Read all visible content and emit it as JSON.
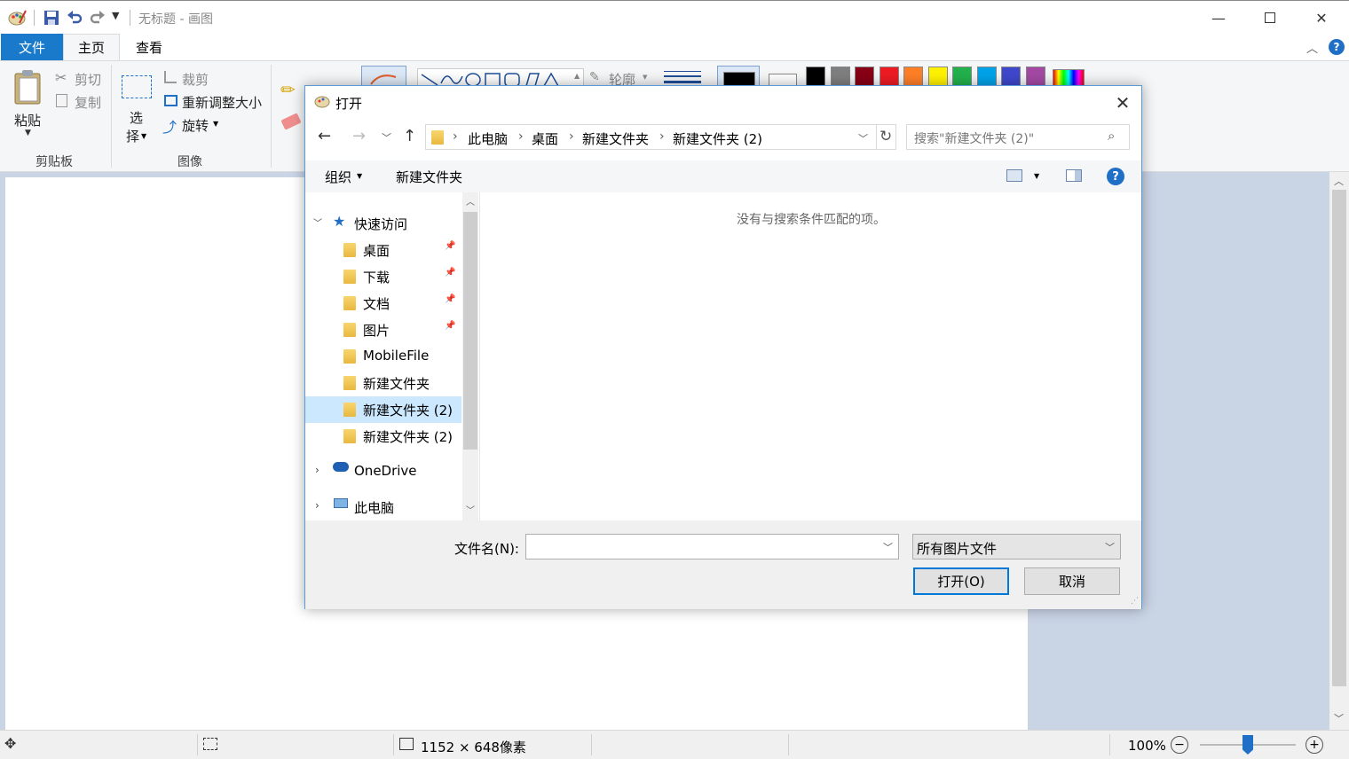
{
  "window": {
    "title": "无标题 - 画图",
    "minimize_icon": "minimize-icon",
    "maximize_icon": "maximize-icon",
    "close_icon": "close-icon"
  },
  "ribbon": {
    "tabs": [
      {
        "label": "文件"
      },
      {
        "label": "主页"
      },
      {
        "label": "查看"
      }
    ],
    "clipboard": {
      "paste_label": "粘贴",
      "cut_label": "剪切",
      "copy_label": "复制",
      "group_label": "剪贴板"
    },
    "image": {
      "select_label": "选",
      "select_label2": "择",
      "crop_label": "裁剪",
      "resize_label": "重新调整大小",
      "rotate_label": "旋转",
      "group_label": "图像"
    },
    "shapes": {
      "outline_label": "轮廓"
    },
    "colors": {
      "color1": "#000000",
      "palette": [
        "#000000",
        "#7f7f7f",
        "#880015",
        "#ed1c24",
        "#ff7f27",
        "#fff200",
        "#22b14c",
        "#00a2e8",
        "#3f48cc",
        "#a349a4"
      ]
    }
  },
  "statusbar": {
    "canvas_size": "1152 × 648像素",
    "zoom": "100%",
    "zoom_out_icon": "zoom-out-icon",
    "zoom_in_icon": "zoom-in-icon",
    "zoom_level": 1.0
  },
  "dialog": {
    "title": "打开",
    "breadcrumb": [
      "此电脑",
      "桌面",
      "新建文件夹",
      "新建文件夹 (2)"
    ],
    "search_placeholder": "搜索\"新建文件夹 (2)\"",
    "organize_label": "组织",
    "new_folder_label": "新建文件夹",
    "nav": {
      "quick_access": "快速访问",
      "items": [
        {
          "label": "桌面",
          "pinned": true
        },
        {
          "label": "下载",
          "pinned": true
        },
        {
          "label": "文档",
          "pinned": true
        },
        {
          "label": "图片",
          "pinned": true
        },
        {
          "label": "MobileFile",
          "pinned": false
        },
        {
          "label": "新建文件夹",
          "pinned": false
        },
        {
          "label": "新建文件夹 (2)",
          "pinned": false,
          "selected": true
        },
        {
          "label": "新建文件夹 (2)",
          "pinned": false
        }
      ],
      "onedrive": "OneDrive",
      "this_pc": "此电脑"
    },
    "empty_message": "没有与搜索条件匹配的项。",
    "filename_label": "文件名(N):",
    "filename_value": "",
    "filetype_value": "所有图片文件",
    "open_button": "打开(O)",
    "cancel_button": "取消"
  }
}
